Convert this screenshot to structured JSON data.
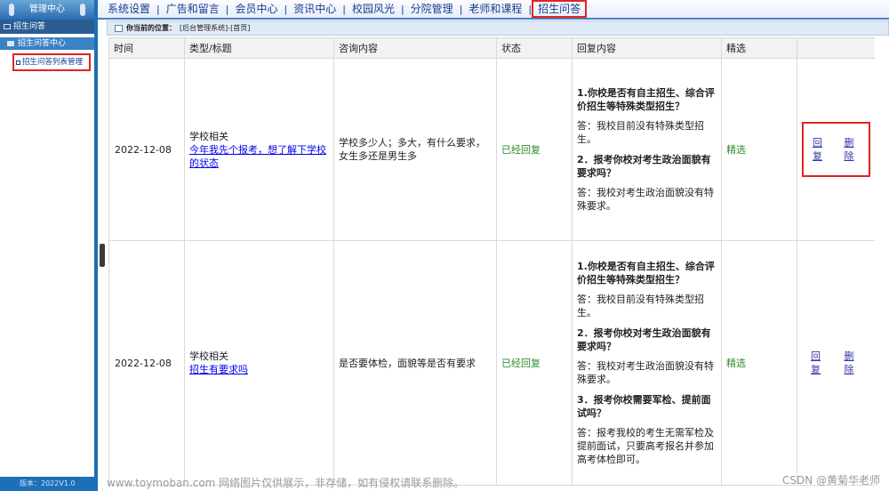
{
  "sidebar": {
    "title": "管理中心",
    "tab": "招生问答",
    "group": "招生问答中心",
    "item": "招生问答列表管理",
    "footer": "版本：2022V1.0"
  },
  "nav": {
    "items": [
      "系统设置",
      "广告和留言",
      "会员中心",
      "资讯中心",
      "校园风光",
      "分院管理",
      "老师和课程",
      "招生问答"
    ],
    "active_index": 7
  },
  "breadcrumb": {
    "label": "你当前的位置：",
    "path": "[后台管理系统]-[首页]"
  },
  "table": {
    "headers": [
      "时间",
      "类型/标题",
      "咨询内容",
      "状态",
      "回复内容",
      "精选",
      ""
    ],
    "rows": [
      {
        "date": "2022-12-08",
        "type": "学校相关",
        "title": "今年我先个报考，想了解下学校的状态",
        "content": "学校多少人；多大，有什么要求，女生多还是男生多",
        "status": "已经回复",
        "qa": [
          {
            "q": "1.你校是否有自主招生、综合评价招生等特殊类型招生？",
            "a": "答：我校目前没有特殊类型招生。"
          },
          {
            "q": "2．报考你校对考生政治面貌有要求吗？",
            "a": "答：我校对考生政治面貌没有特殊要求。"
          }
        ],
        "featured": "精选",
        "reply": "回复",
        "delete": "删除"
      },
      {
        "date": "2022-12-08",
        "type": "学校相关",
        "title": "招生有要求吗",
        "content": "是否要体检，面貌等是否有要求",
        "status": "已经回复",
        "qa": [
          {
            "q": "1.你校是否有自主招生、综合评价招生等特殊类型招生？",
            "a": "答：我校目前没有特殊类型招生。"
          },
          {
            "q": "2．报考你校对考生政治面貌有要求吗？",
            "a": "答：我校对考生政治面貌没有特殊要求。"
          },
          {
            "q": "3．报考你校需要军检、提前面试吗？",
            "a": "答：报考我校的考生无需军检及提前面试，只要高考报名并参加高考体检即可。"
          }
        ],
        "featured": "精选",
        "reply": "回复",
        "delete": "删除"
      }
    ]
  },
  "watermark": {
    "left": "www.toymoban.com 网络图片仅供展示，非存储，如有侵权请联系删除。",
    "right": "CSDN @黄菊华老师"
  }
}
